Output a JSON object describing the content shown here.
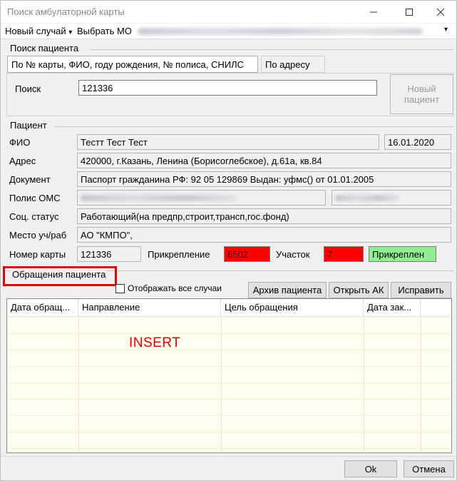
{
  "window": {
    "title": "Поиск амбулаторной карты"
  },
  "menu": {
    "new_case": "Новый случай",
    "new_case_arrow": "▾",
    "choose_mo": "Выбрать МО",
    "dropdown_arrow": "▾"
  },
  "search": {
    "group_label": "Поиск пациента",
    "tab_main": "По № карты, ФИО, году рождения, № полиса, СНИЛС",
    "tab_address": "По адресу",
    "search_label": "Поиск",
    "search_value": "121336",
    "new_patient_line1": "Новый",
    "new_patient_line2": "пациент"
  },
  "patient": {
    "group_label": "Пациент",
    "fio_label": "ФИО",
    "fio_value": "Тестт Тест Тест",
    "birth_date": "16.01.2020",
    "address_label": "Адрес",
    "address_value": "420000, г.Казань, Ленина (Борисоглебское), д.61а, кв.84",
    "document_label": "Документ",
    "document_value": "Паспорт гражданина РФ: 92 05 129869 Выдан: уфмс() от 01.01.2005",
    "oms_label": "Полис ОМС",
    "social_label": "Соц. статус",
    "social_value": "Работающий(на предпр,строит,трансп,гос.фонд)",
    "place_label": "Место уч/раб",
    "place_value": "АО \"КМПО\",",
    "card_label": "Номер карты",
    "card_value": "121336",
    "attach_label": "Прикрепление",
    "attach_value": "6502",
    "area_label": "Участок",
    "area_value": "7",
    "status_value": "Прикреплен"
  },
  "appeals": {
    "group_label": "Обращения пациента",
    "show_all_label": "Отображать все случаи",
    "archive_button": "Архив пациента",
    "open_button": "Открыть АК",
    "fix_button": "Исправить",
    "columns": [
      "Дата обращ...",
      "Направление",
      "Цель обращения",
      "Дата зак..."
    ],
    "insert_text": "INSERT"
  },
  "footer": {
    "ok": "Ok",
    "cancel": "Отмена"
  },
  "colors": {
    "highlight": "#e00000",
    "attach_bg": "#ff0000",
    "status_bg": "#90ee90",
    "grid_bg": "#fffff0"
  }
}
